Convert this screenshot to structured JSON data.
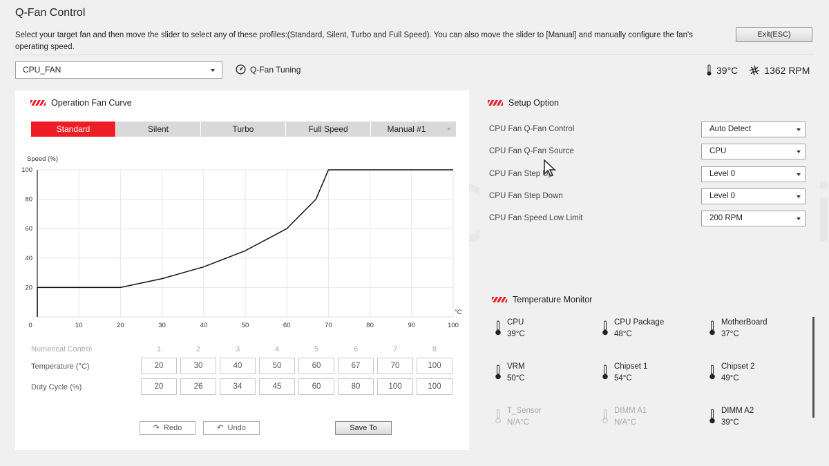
{
  "window": {
    "title": "Q-Fan Control",
    "description": "Select your target fan and then move the slider to select any of these profiles:(Standard, Silent, Turbo and Full Speed). You can also move the slider to [Manual] and manually configure the fan's operating speed.",
    "exit_label": "Exit(ESC)"
  },
  "toolbar": {
    "fan_selected": "CPU_FAN",
    "qfan_tuning_label": "Q-Fan Tuning",
    "temperature": "39°C",
    "rpm": "1362 RPM"
  },
  "watermark": "PROFESIONAL review",
  "fan_curve": {
    "title": "Operation Fan Curve",
    "tabs": [
      {
        "label": "Standard",
        "active": true
      },
      {
        "label": "Silent",
        "active": false
      },
      {
        "label": "Turbo",
        "active": false
      },
      {
        "label": "Full Speed",
        "active": false
      },
      {
        "label": "Manual #1",
        "active": false
      }
    ]
  },
  "chart_data": {
    "type": "line",
    "ylabel": "Speed (%)",
    "xlabel": "°C",
    "xlim": [
      0,
      100
    ],
    "ylim": [
      0,
      100
    ],
    "x_ticks": [
      0,
      10,
      20,
      30,
      40,
      50,
      60,
      70,
      80,
      90,
      100
    ],
    "y_ticks": [
      20,
      40,
      60,
      80,
      100
    ],
    "grid": true,
    "series": [
      {
        "x": [
          0,
          0,
          20,
          30,
          40,
          50,
          60,
          67,
          70,
          100
        ],
        "y": [
          0,
          20,
          20,
          26,
          34,
          45,
          60,
          80,
          100,
          100
        ]
      }
    ]
  },
  "numerical": {
    "header_label": "Numerical Control",
    "indices": [
      "1",
      "2",
      "3",
      "4",
      "5",
      "6",
      "7",
      "8"
    ],
    "temperature_label": "Temperature (°C)",
    "temperature": [
      "20",
      "30",
      "40",
      "50",
      "60",
      "67",
      "70",
      "100"
    ],
    "duty_label": "Duty Cycle (%)",
    "duty": [
      "20",
      "26",
      "34",
      "45",
      "60",
      "80",
      "100",
      "100"
    ],
    "redo_label": "Redo",
    "undo_label": "Undo",
    "save_label": "Save To"
  },
  "setup": {
    "title": "Setup Option",
    "options": [
      {
        "label": "CPU Fan Q-Fan Control",
        "value": "Auto Detect"
      },
      {
        "label": "CPU Fan Q-Fan Source",
        "value": "CPU"
      },
      {
        "label": "CPU Fan Step Up",
        "value": "Level 0"
      },
      {
        "label": "CPU Fan Step Down",
        "value": "Level 0"
      },
      {
        "label": "CPU Fan Speed Low Limit",
        "value": "200 RPM"
      }
    ]
  },
  "temp_monitor": {
    "title": "Temperature Monitor",
    "items": [
      {
        "name": "CPU",
        "value": "39°C",
        "active": true
      },
      {
        "name": "CPU Package",
        "value": "48°C",
        "active": true
      },
      {
        "name": "MotherBoard",
        "value": "37°C",
        "active": true
      },
      {
        "name": "VRM",
        "value": "50°C",
        "active": true
      },
      {
        "name": "Chipset 1",
        "value": "54°C",
        "active": true
      },
      {
        "name": "Chipset 2",
        "value": "49°C",
        "active": true
      },
      {
        "name": "T_Sensor",
        "value": "N/A°C",
        "active": false
      },
      {
        "name": "DIMM A1",
        "value": "N/A°C",
        "active": false
      },
      {
        "name": "DIMM A2",
        "value": "39°C",
        "active": true
      }
    ]
  },
  "colors": {
    "accent": "#ee1c25",
    "tab_inactive": "#d9d9d9",
    "grid": "#e6e6e6"
  }
}
